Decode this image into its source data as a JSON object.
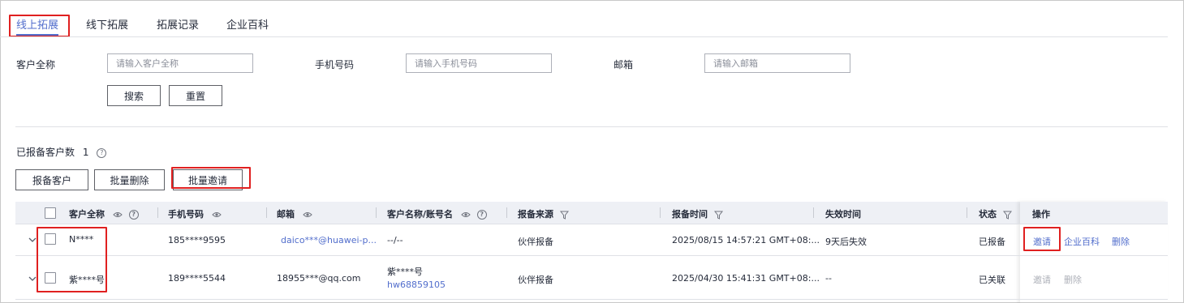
{
  "tabs": [
    {
      "label": "线上拓展",
      "active": true
    },
    {
      "label": "线下拓展",
      "active": false
    },
    {
      "label": "拓展记录",
      "active": false
    },
    {
      "label": "企业百科",
      "active": false
    }
  ],
  "filters": {
    "customer_name_label": "客户全称",
    "customer_name_placeholder": "请输入客户全称",
    "phone_label": "手机号码",
    "phone_placeholder": "请输入手机号码",
    "email_label": "邮箱",
    "email_placeholder": "请输入邮箱",
    "search_label": "搜索",
    "reset_label": "重置"
  },
  "summary": {
    "label": "已报备客户数",
    "count": "1"
  },
  "toolbar": {
    "report_label": "报备客户",
    "batch_delete_label": "批量删除",
    "batch_invite_label": "批量邀请"
  },
  "table": {
    "columns": {
      "customer_name": "客户全称",
      "phone": "手机号码",
      "email": "邮箱",
      "account_name": "客户名称/账号名",
      "source": "报备来源",
      "report_time": "报备时间",
      "expire_time": "失效时间",
      "status": "状态",
      "actions": "操作"
    },
    "rows": [
      {
        "customer_name": "N****",
        "phone": "185****9595",
        "email": "daico***@huawei-p...",
        "account_name": "--/--",
        "account_id": "",
        "source": "伙伴报备",
        "report_time": "2025/08/15 14:57:21 GMT+08:...",
        "expire_time": "9天后失效",
        "status": "已报备",
        "action_invite": "邀请",
        "action_wiki": "企业百科",
        "action_delete": "删除"
      },
      {
        "customer_name": "紫****号",
        "phone": "189****5544",
        "email": "18955***@qq.com",
        "account_name": "紫****号",
        "account_id": "hw68859105",
        "source": "伙伴报备",
        "report_time": "2025/04/30 15:41:31 GMT+08:...",
        "expire_time": "--",
        "status": "已关联",
        "action_invite": "邀请",
        "action_delete": "删除"
      }
    ]
  },
  "colors": {
    "accent": "#526ecc",
    "highlight_box": "#e02020",
    "header_bg": "#eef0f5"
  }
}
